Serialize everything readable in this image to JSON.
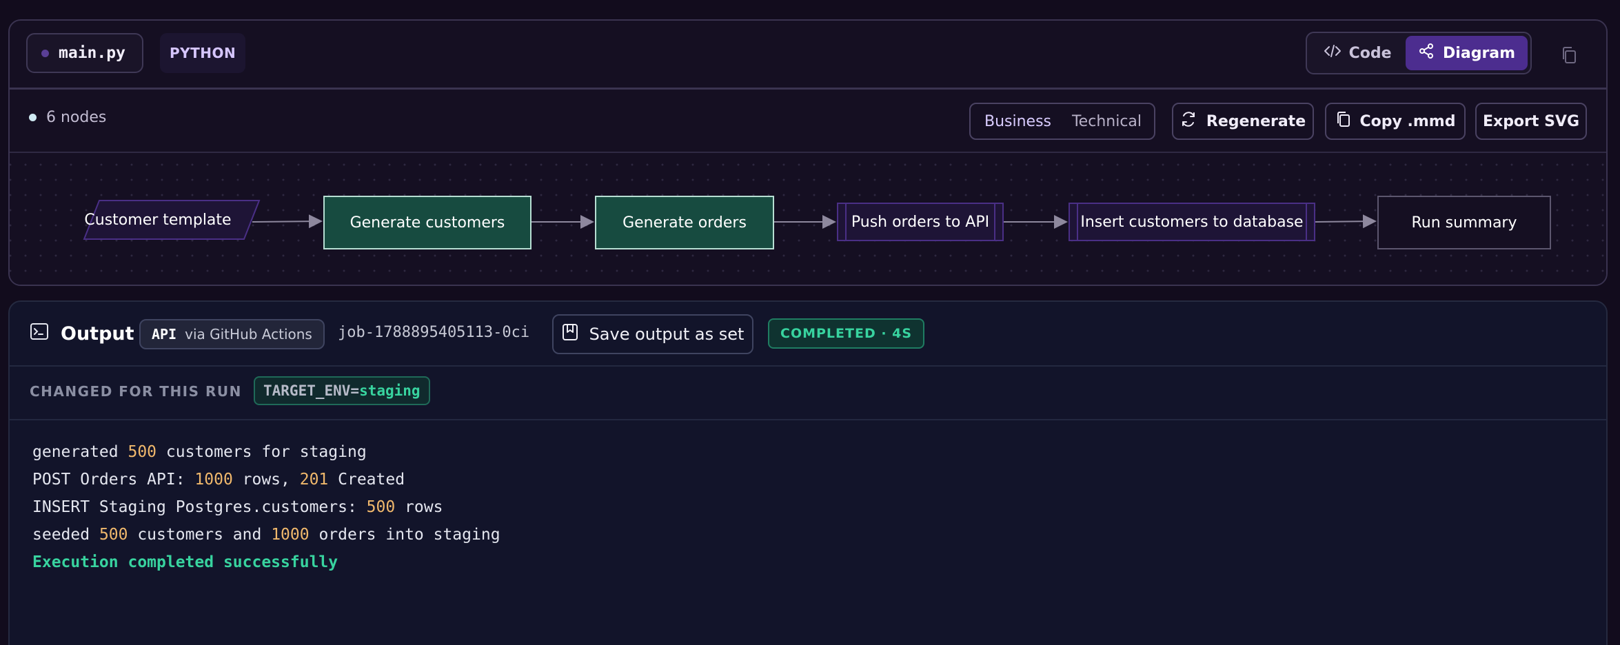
{
  "file": {
    "name": "main.py",
    "language": "PYTHON"
  },
  "view_toggle": {
    "code_label": "Code",
    "diagram_label": "Diagram",
    "active": "Diagram"
  },
  "toolbar": {
    "nodes_count": "6 nodes",
    "mode_business": "Business",
    "mode_technical": "Technical",
    "regenerate_label": "Regenerate",
    "copy_mmd_label": "Copy .mmd",
    "export_svg_label": "Export SVG"
  },
  "diagram": {
    "nodes": [
      {
        "label": "Customer template",
        "shape": "parallelogram"
      },
      {
        "label": "Generate customers",
        "shape": "process"
      },
      {
        "label": "Generate orders",
        "shape": "process"
      },
      {
        "label": "Push orders to API",
        "shape": "subroutine"
      },
      {
        "label": "Insert customers to database",
        "shape": "subroutine"
      },
      {
        "label": "Run summary",
        "shape": "terminal"
      }
    ]
  },
  "output": {
    "title": "Output",
    "trigger_badge": "API",
    "trigger_text": "via GitHub Actions",
    "job_id": "job-1788895405113-0ci",
    "save_label": "Save output as set",
    "status": "COMPLETED · 4S",
    "changed_label": "CHANGED FOR THIS RUN",
    "env_key": "TARGET_ENV=",
    "env_value": "staging"
  },
  "log": {
    "l1_a": "generated ",
    "l1_n": "500",
    "l1_b": " customers for staging",
    "l2_a": "POST Orders API: ",
    "l2_n1": "1000",
    "l2_b": " rows, ",
    "l2_n2": "201",
    "l2_c": " Created",
    "l3_a": "INSERT Staging Postgres.customers: ",
    "l3_n": "500",
    "l3_b": " rows",
    "l4_a": "seeded ",
    "l4_n1": "500",
    "l4_b": " customers and ",
    "l4_n2": "1000",
    "l4_c": " orders into staging",
    "l5": "Execution completed successfully"
  },
  "colors": {
    "accent_purple": "#4c2d8f",
    "node_green": "#174b40",
    "success_green": "#38d39f",
    "number_orange": "#f0b86c"
  }
}
